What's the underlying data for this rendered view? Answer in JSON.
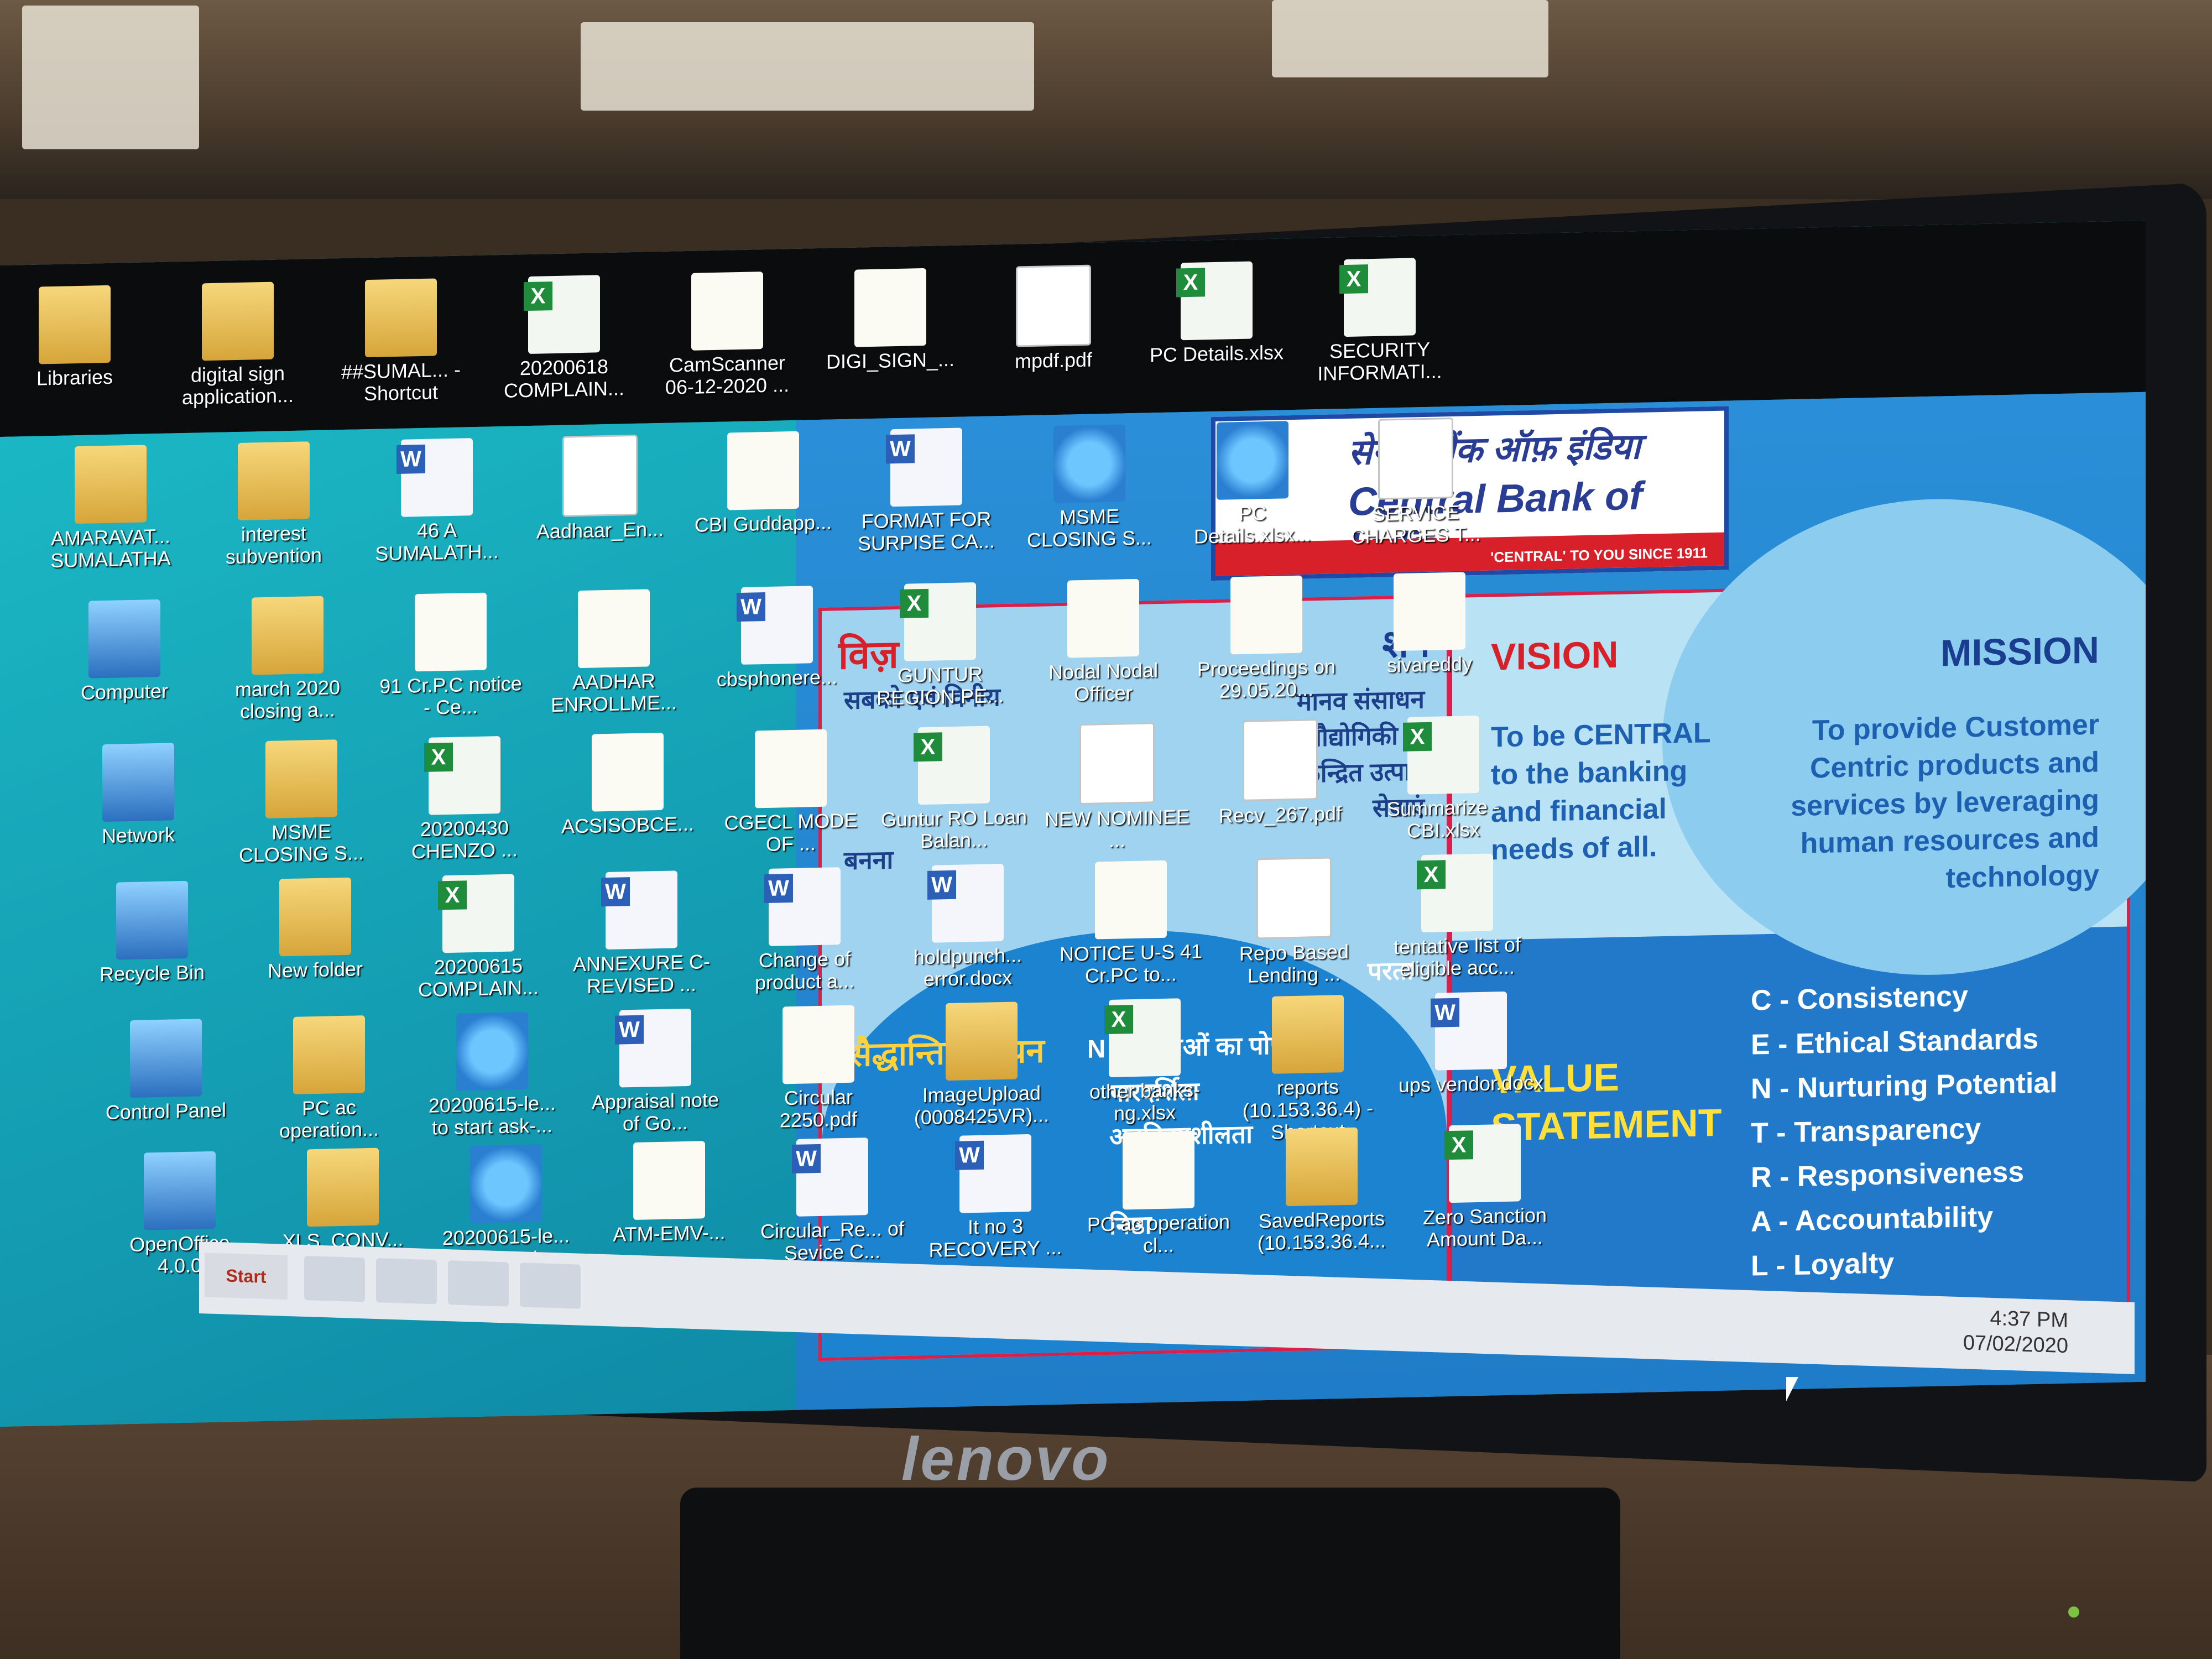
{
  "desktop": {
    "top_icons": [
      {
        "label": "Libraries",
        "type": "folder"
      },
      {
        "label": "digital sign application...",
        "type": "folder"
      },
      {
        "label": "##SUMAL... - Shortcut",
        "type": "folder"
      },
      {
        "label": "20200618 COMPLAIN...",
        "type": "xls"
      },
      {
        "label": "CamScanner 06-12-2020 ...",
        "type": "doc"
      },
      {
        "label": "DIGI_SIGN_...",
        "type": "doc"
      },
      {
        "label": "mpdf.pdf",
        "type": "pdf"
      },
      {
        "label": "PC Details.xlsx",
        "type": "xls"
      },
      {
        "label": "SECURITY INFORMATI...",
        "type": "xls"
      }
    ],
    "row2_icons": [
      {
        "label": "AMARAVAT... SUMALATHA",
        "type": "folder"
      },
      {
        "label": "interest subvention",
        "type": "folder"
      },
      {
        "label": "46 A SUMALATH...",
        "type": "word"
      },
      {
        "label": "Aadhaar_En...",
        "type": "pdf"
      },
      {
        "label": "CBI Guddapp...",
        "type": "doc"
      },
      {
        "label": "FORMAT FOR SURPISE CA...",
        "type": "word"
      },
      {
        "label": "MSME CLOSING S...",
        "type": "ie"
      },
      {
        "label": "PC Details.xlsx...",
        "type": "ie"
      },
      {
        "label": "SERVICE CHARGES T...",
        "type": "pdf"
      }
    ],
    "row3_icons": [
      {
        "label": "Computer",
        "type": "sys"
      },
      {
        "label": "march 2020 closing a...",
        "type": "folder"
      },
      {
        "label": "91 Cr.P.C notice - Ce...",
        "type": "doc"
      },
      {
        "label": "AADHAR ENROLLME...",
        "type": "doc"
      },
      {
        "label": "cbsphonere...",
        "type": "word"
      },
      {
        "label": "GUNTUR REGION PE...",
        "type": "xls"
      },
      {
        "label": "Nodal Nodal Officer",
        "type": "doc"
      },
      {
        "label": "Proceedings on 29.05.20...",
        "type": "doc"
      },
      {
        "label": "sivareddy",
        "type": "doc"
      }
    ],
    "row4_icons": [
      {
        "label": "Network",
        "type": "sys"
      },
      {
        "label": "MSME CLOSING S...",
        "type": "folder"
      },
      {
        "label": "20200430 CHENZO ...",
        "type": "xls"
      },
      {
        "label": "ACSISOBCE...",
        "type": "doc"
      },
      {
        "label": "CGECL MODE OF ...",
        "type": "doc"
      },
      {
        "label": "Guntur RO Loan Balan...",
        "type": "xls"
      },
      {
        "label": "NEW NOMINEE ...",
        "type": "pdf"
      },
      {
        "label": "Recv_267.pdf",
        "type": "pdf"
      },
      {
        "label": "Summarize - CBI.xlsx",
        "type": "xls"
      }
    ],
    "row5_icons": [
      {
        "label": "Recycle Bin",
        "type": "sys"
      },
      {
        "label": "New folder",
        "type": "folder"
      },
      {
        "label": "20200615 COMPLAIN...",
        "type": "xls"
      },
      {
        "label": "ANNEXURE C- REVISED ...",
        "type": "word"
      },
      {
        "label": "Change of product a...",
        "type": "word"
      },
      {
        "label": "holdpunch... error.docx",
        "type": "word"
      },
      {
        "label": "NOTICE U-S 41 Cr.PC to...",
        "type": "doc"
      },
      {
        "label": "Repo Based Lending ...",
        "type": "pdf"
      },
      {
        "label": "tentative list of eligible acc...",
        "type": "xls"
      }
    ],
    "row6_icons": [
      {
        "label": "Control Panel",
        "type": "sys"
      },
      {
        "label": "PC ac operation...",
        "type": "folder"
      },
      {
        "label": "20200615-le... to start ask-...",
        "type": "ie"
      },
      {
        "label": "Appraisal note of Go...",
        "type": "word"
      },
      {
        "label": "Circular 2250.pdf",
        "type": "doc"
      },
      {
        "label": "ImageUpload (0008425VR)...",
        "type": "folder"
      },
      {
        "label": "other banks-ng.xlsx",
        "type": "xls"
      },
      {
        "label": "reports (10.153.36.4) - Shortcut",
        "type": "folder"
      },
      {
        "label": "ups vendor.docx",
        "type": "word"
      }
    ],
    "row7_icons": [
      {
        "label": "OpenOffice 4.0.0",
        "type": "sys"
      },
      {
        "label": "XLS_CONV...",
        "type": "folder"
      },
      {
        "label": "20200615-le... to start ask-...",
        "type": "ie"
      },
      {
        "label": "ATM-EMV-...",
        "type": "doc"
      },
      {
        "label": "Circular_Re... of Sevice C...",
        "type": "word"
      },
      {
        "label": "It no 3 RECOVERY ...",
        "type": "word"
      },
      {
        "label": "PC ac operation cl...",
        "type": "doc"
      },
      {
        "label": "SavedReports (10.153.36.4...",
        "type": "folder"
      },
      {
        "label": "Zero Sanction Amount Da...",
        "type": "xls"
      }
    ]
  },
  "wallpaper": {
    "logo_hindi": "सेन्ट्रल बैंक ऑफ़ इंडिया",
    "logo_english": "Central Bank of India",
    "logo_tagline": "'CENTRAL' TO YOU SINCE 1911",
    "poster_title_left": "विज़",
    "poster_title_right": "शन",
    "poster_lines": [
      "सबको एवं विनीय",
      "मानव संसाधन",
      "एवं प्रौद्योगिकी के",
      "केन्द्रित उत्पाद",
      "सेवाएं",
      "बनना",
      "उत्तरदायी",
      "परता",
      "N - क्षमताओं का पोषण",
      "पारदर्शिता",
      "अनुक्रियाशीलता",
      "निष्ठा"
    ],
    "poster_value_statement": "सैद्धान्तिक कथन",
    "vision_heading": "VISION",
    "vision_text": "To be CENTRAL to the banking and financial needs of all.",
    "mission_heading": "MISSION",
    "mission_text": "To provide Customer Centric products and services by leveraging human resources and technology",
    "value_statement": "VALUE STATEMENT",
    "values": [
      "C - Consistency",
      "E - Ethical Standards",
      "N - Nurturing Potential",
      "T - Transparency",
      "R - Responsiveness",
      "A - Accountability",
      "L - Loyalty"
    ]
  },
  "taskbar": {
    "start_label": "Start",
    "clock_time": "4:37 PM",
    "clock_date": "07/02/2020"
  },
  "monitor": {
    "brand": "lenovo"
  }
}
